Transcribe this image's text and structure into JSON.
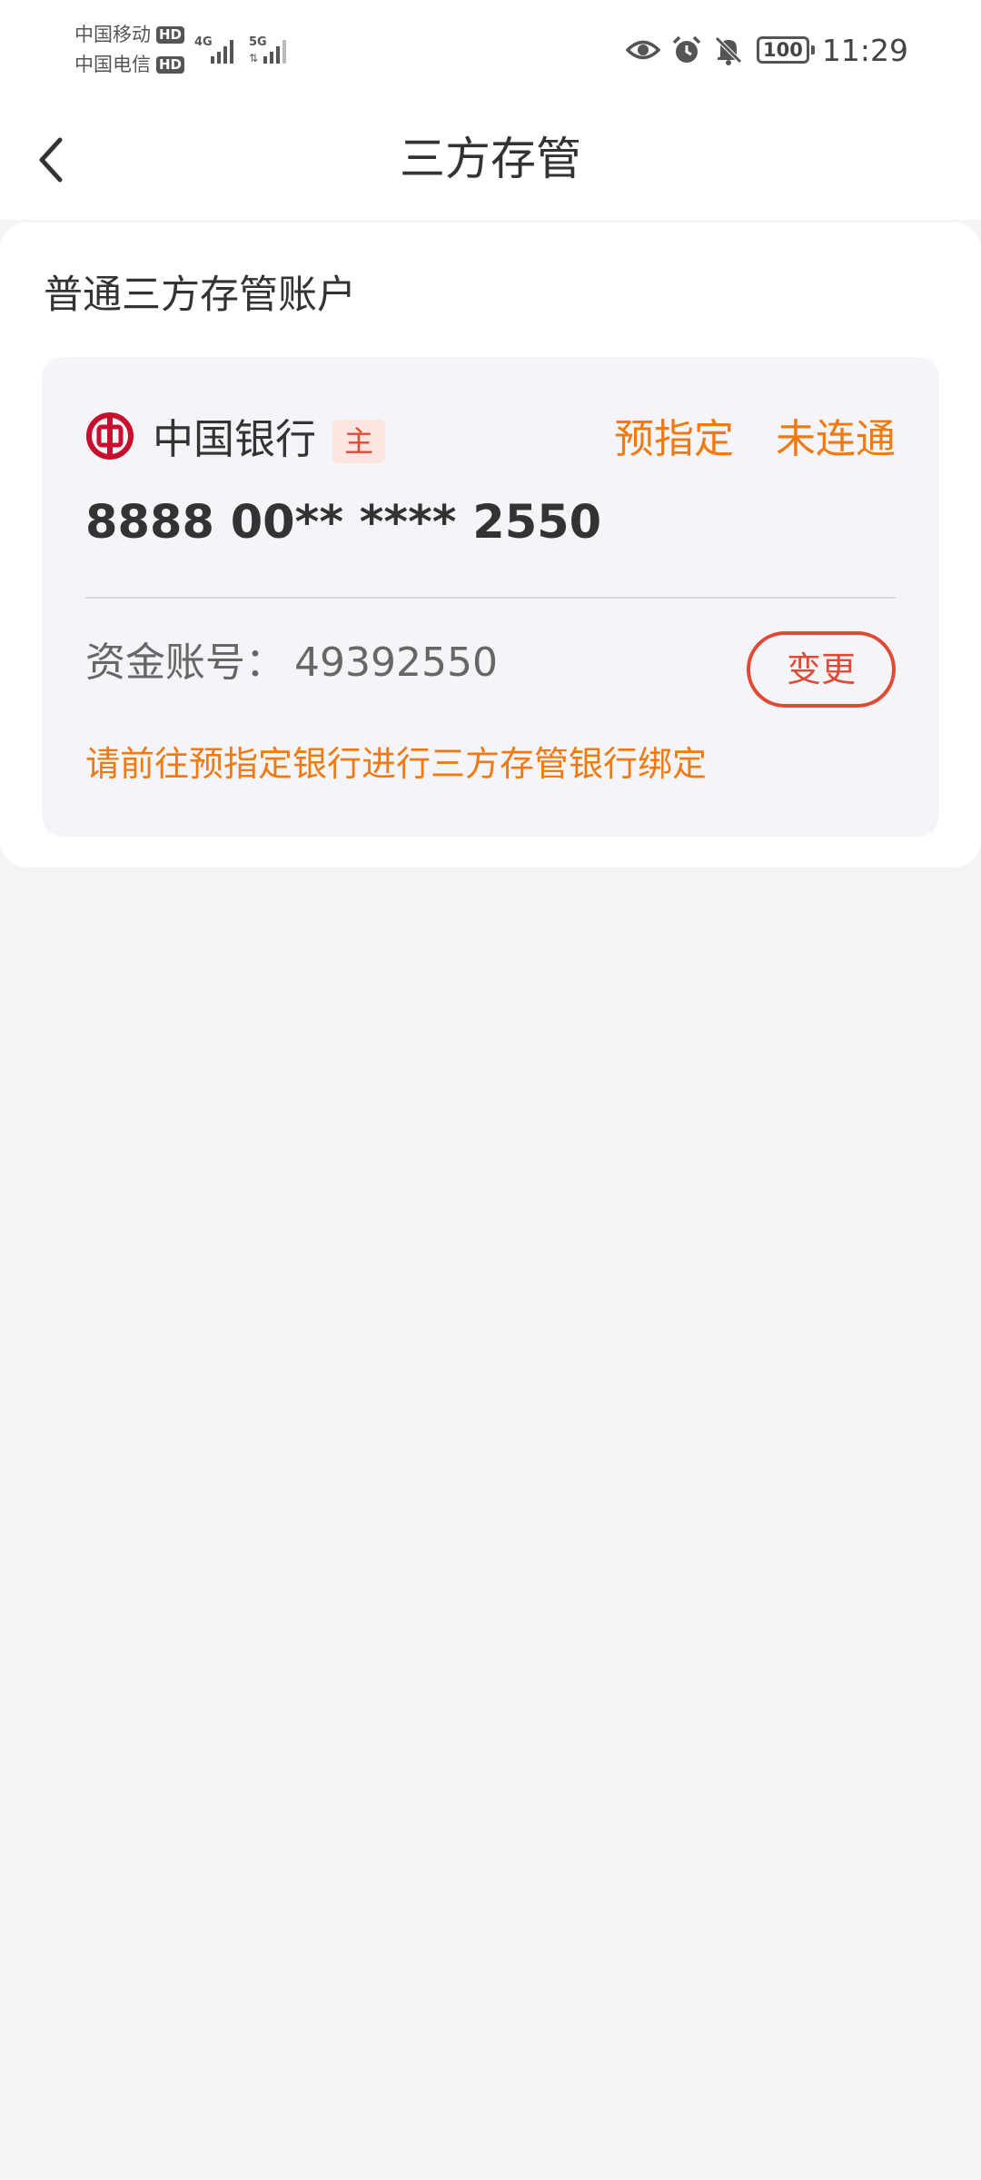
{
  "status_bar": {
    "carrier1": "中国移动",
    "carrier2": "中国电信",
    "hd_label": "HD",
    "network1": "4G",
    "network2": "5G",
    "icons": [
      "eye-icon",
      "alarm-icon",
      "mute-bell-icon"
    ],
    "battery": "100",
    "time": "11:29"
  },
  "nav": {
    "back_icon": "chevron-left-icon",
    "title": "三方存管"
  },
  "section": {
    "title": "普通三方存管账户"
  },
  "bank_card": {
    "logo_icon": "bank-of-china-logo",
    "bank_name": "中国银行",
    "badge": "主",
    "pre_assigned": "预指定",
    "connection_status": "未连通",
    "card_number": "8888 00** **** 2550",
    "fund_account_label": "资金账号：",
    "fund_account_value": "49392550",
    "change_button": "变更",
    "hint": "请前往预指定银行进行三方存管银行绑定"
  },
  "colors": {
    "accent_orange": "#f07a12",
    "accent_red": "#e04a34",
    "bank_logo_red": "#c8102e",
    "background": "#f4f4f5",
    "card_background": "#f5f5f9"
  }
}
